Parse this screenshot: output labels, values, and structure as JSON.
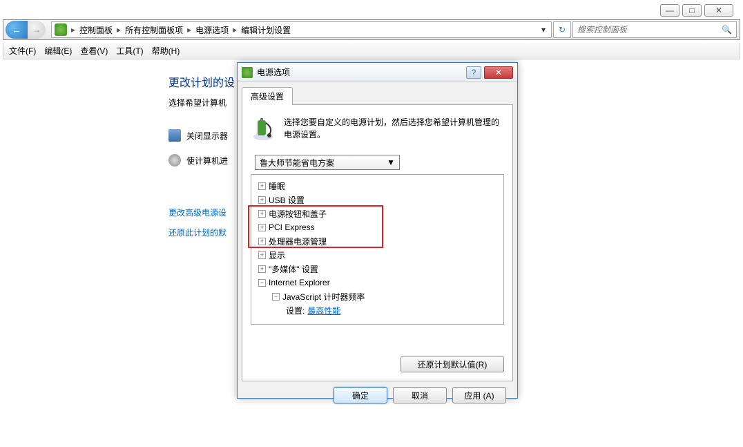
{
  "window_controls": {
    "min": "—",
    "max": "□",
    "close": "✕"
  },
  "nav": {
    "back": "←",
    "forward": "→"
  },
  "breadcrumb": {
    "items": [
      "控制面板",
      "所有控制面板项",
      "电源选项",
      "编辑计划设置"
    ],
    "arrow": "▸",
    "dropdown": "▾"
  },
  "refresh": "↻",
  "search": {
    "placeholder": "搜索控制面板",
    "icon": "🔍"
  },
  "menu": {
    "file": "文件(F)",
    "edit": "编辑(E)",
    "view": "查看(V)",
    "tools": "工具(T)",
    "help": "帮助(H)"
  },
  "page": {
    "title": "更改计划的设",
    "subtitle": "选择希望计算机",
    "opt_monitor": "关闭显示器",
    "opt_sleep": "使计算机进",
    "link_adv": "更改高级电源设",
    "link_restore": "还原此计划的默",
    "cancel": "取消"
  },
  "dialog": {
    "title": "电源选项",
    "help": "?",
    "close": "✕",
    "tab": "高级设置",
    "desc": "选择您要自定义的电源计划，然后选择您希望计算机管理的电源设置。",
    "plan": "鲁大师节能省电方案",
    "dropdown": "▼",
    "tree": {
      "sleep": "睡眠",
      "usb": "USB 设置",
      "power_btn": "电源按钮和盖子",
      "pci": "PCI Express",
      "cpu": "处理器电源管理",
      "display": "显示",
      "media": "\"多媒体\" 设置",
      "ie": "Internet Explorer",
      "js": "JavaScript 计时器频率",
      "setting_label": "设置: ",
      "setting_value": "最高性能"
    },
    "restore": "还原计划默认值(R)",
    "ok": "确定",
    "cancel": "取消",
    "apply": "应用 (A)"
  }
}
